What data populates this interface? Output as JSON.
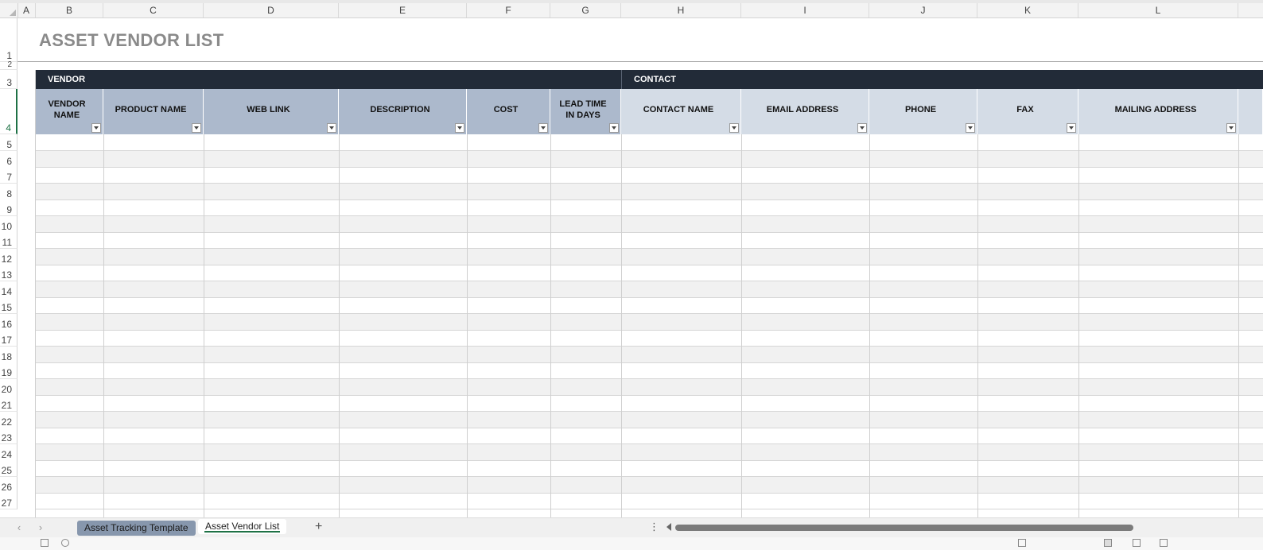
{
  "sheet": {
    "title": "ASSET VENDOR LIST",
    "column_letters": [
      "A",
      "B",
      "C",
      "D",
      "E",
      "F",
      "G",
      "H",
      "I",
      "J",
      "K",
      "L"
    ],
    "row_numbers": [
      "1",
      "2",
      "3",
      "4",
      "5",
      "6",
      "7",
      "8",
      "9",
      "10",
      "11",
      "12",
      "13",
      "14",
      "15",
      "16",
      "17",
      "18",
      "19",
      "20",
      "21",
      "22",
      "23",
      "24",
      "25",
      "26",
      "27"
    ],
    "sections": {
      "vendor": "VENDOR",
      "contact": "CONTACT"
    },
    "headers": {
      "vendor_name": "VENDOR NAME",
      "product_name": "PRODUCT NAME",
      "web_link": "WEB LINK",
      "description": "DESCRIPTION",
      "cost": "COST",
      "lead_time": "LEAD TIME IN DAYS",
      "contact_name": "CONTACT NAME",
      "email_address": "EMAIL ADDRESS",
      "phone": "PHONE",
      "fax": "FAX",
      "mailing_address": "MAILING ADDRESS"
    },
    "colors": {
      "band": "#222b38",
      "vendor_header": "#acb9cc",
      "contact_header": "#d4dce6",
      "alt_row": "#f1f1f1",
      "active_accent": "#1e7145"
    }
  },
  "tabs": {
    "items": [
      "Asset Tracking Template",
      "Asset Vendor List"
    ],
    "active": "Asset Vendor List",
    "add_icon": "plus-icon"
  },
  "navigation": {
    "prev_icon": "chevron-left-icon",
    "next_icon": "chevron-right-icon"
  }
}
